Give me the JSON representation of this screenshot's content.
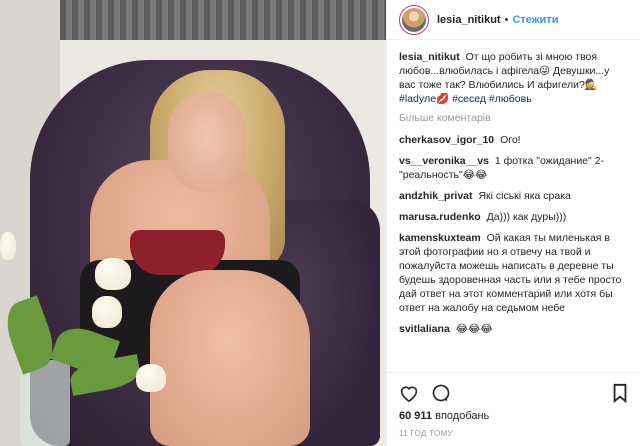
{
  "header": {
    "username": "lesia_nitikut",
    "separator": "•",
    "follow_label": "Стежити"
  },
  "caption": {
    "username": "lesia_nitikut",
    "text": "От що робить зі мною твоя любов...влюбилась і афігела😜 Девушки...у вас тоже так? Влюбились И афигели?🕵",
    "tags": [
      "#ladyле💋",
      "#сесед",
      "#любовь"
    ]
  },
  "more_comments_label": "Більше коментарів",
  "comments": [
    {
      "user": "cherkasov_igor_10",
      "text": "Ого!"
    },
    {
      "user": "vs__veronika__vs",
      "text": "1 фотка \"ожидание\" 2- \"реальность\"😂😂"
    },
    {
      "user": "andzhik_privat",
      "text": "Які сіські яка срака"
    },
    {
      "user": "marusa.rudenko",
      "text": "Да))) как дуры)))"
    },
    {
      "user": "kamenskuxteam",
      "text": "Ой какая ты миленькая в этой фотографии но я отвечу на твой и пожалуйста можешь написать в деревне ты будешь здоровенная часть или я тебе просто дай ответ на этот комментарий или хотя бы ответ на жалобу на седьмом небе"
    },
    {
      "user": "svitlaliana",
      "text": "😂😂😂"
    }
  ],
  "likes": {
    "count": "60 911",
    "label": "вподобань"
  },
  "timestamp": "11 ГОД ТОМУ",
  "icons": {
    "like": "heart-icon",
    "comment": "comment-icon",
    "save": "bookmark-icon"
  }
}
